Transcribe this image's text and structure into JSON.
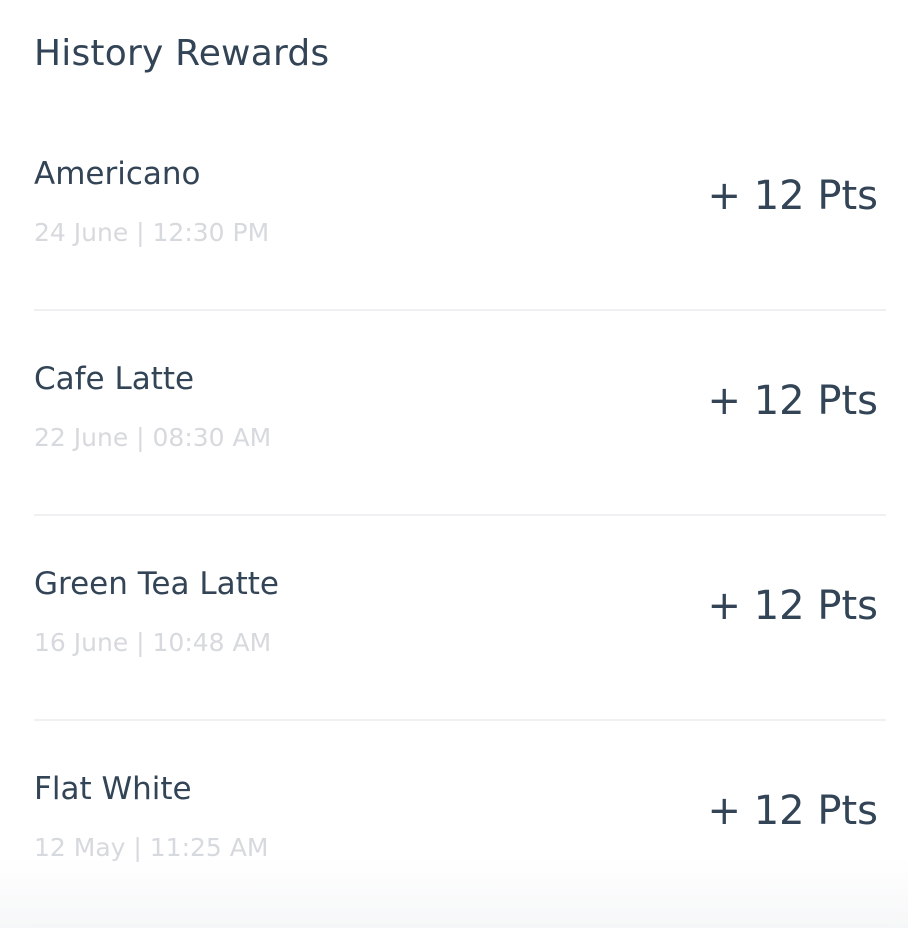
{
  "header": {
    "title": "History Rewards"
  },
  "rewards": [
    {
      "name": "Americano",
      "date": "24 June | 12:30 PM",
      "points": "+ 12 Pts"
    },
    {
      "name": "Cafe Latte",
      "date": "22 June | 08:30 AM",
      "points": "+ 12 Pts"
    },
    {
      "name": "Green Tea Latte",
      "date": "16 June | 10:48 AM",
      "points": "+ 12 Pts"
    },
    {
      "name": "Flat White",
      "date": "12 May | 11:25 AM",
      "points": "+ 12 Pts"
    }
  ],
  "colors": {
    "text_primary": "#324456",
    "text_secondary": "#d6d9dd",
    "divider": "#eef0f2",
    "background": "#ffffff"
  }
}
